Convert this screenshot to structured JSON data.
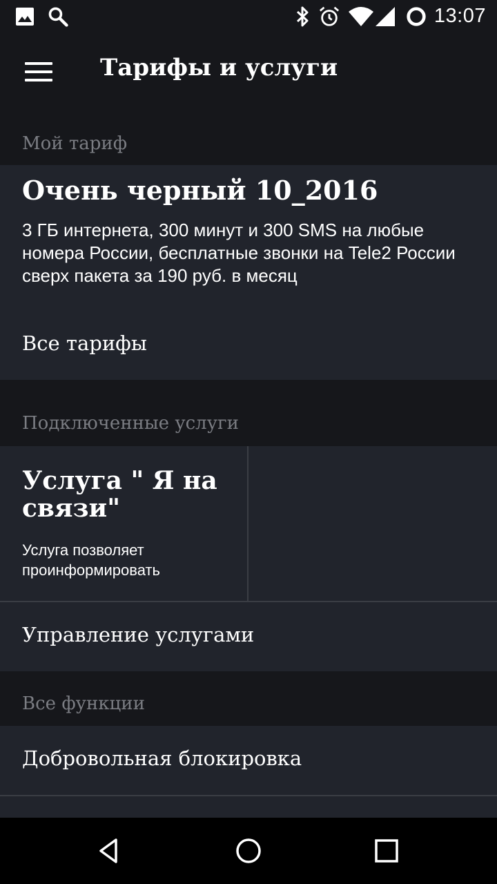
{
  "status_bar": {
    "time": "13:07",
    "left_icons": [
      "image-icon",
      "search-icon"
    ],
    "right_icons": [
      "bluetooth-icon",
      "alarm-icon",
      "wifi-icon",
      "signal-icon",
      "sync-icon"
    ]
  },
  "app_bar": {
    "title": "Тарифы и услуги",
    "menu_icon": "hamburger-menu-icon"
  },
  "my_tariff": {
    "header": "Мой тариф",
    "name": "Очень черный 10_2016",
    "description": "3 ГБ интернета, 300 минут и 300 SMS на любые номера России,  бесплатные звонки на Tele2 России сверх пакета за 190 руб. в месяц",
    "all_tariffs_label": "Все тарифы"
  },
  "connected_services": {
    "header": "Подключенные услуги",
    "items": [
      {
        "title": "Услуга \" Я на связи\"",
        "description": "Услуга позволяет проинформировать"
      }
    ],
    "manage_label": "Управление услугами"
  },
  "all_functions": {
    "header": "Все функции",
    "items": [
      {
        "label": "Добровольная блокировка"
      }
    ]
  },
  "nav_bar": {
    "icons": [
      "back-icon",
      "home-icon",
      "recents-icon"
    ]
  },
  "colors": {
    "background": "#16171b",
    "card": "#21242c",
    "header_text": "#7b7d83",
    "divider": "#3a3d44",
    "nav_bar": "#000000"
  }
}
